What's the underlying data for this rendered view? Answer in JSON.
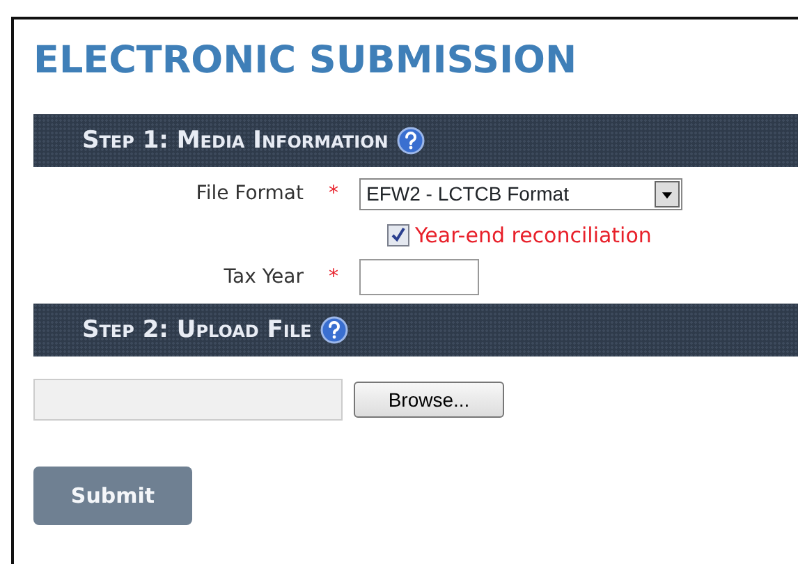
{
  "title": "ELECTRONIC SUBMISSION",
  "step1": {
    "heading": "Step 1: Media Information",
    "fields": [
      {
        "kind": "select",
        "label": "File Format",
        "required_mark": "*",
        "value": "EFW2 - LCTCB Format"
      },
      {
        "kind": "checkbox",
        "label": "Year-end reconciliation",
        "checked": true
      },
      {
        "kind": "text",
        "label": "Tax Year",
        "required_mark": "*"
      }
    ]
  },
  "step2": {
    "heading": "Step 2: Upload File",
    "browse_button": "Browse..."
  },
  "submit_button": "Submit"
}
